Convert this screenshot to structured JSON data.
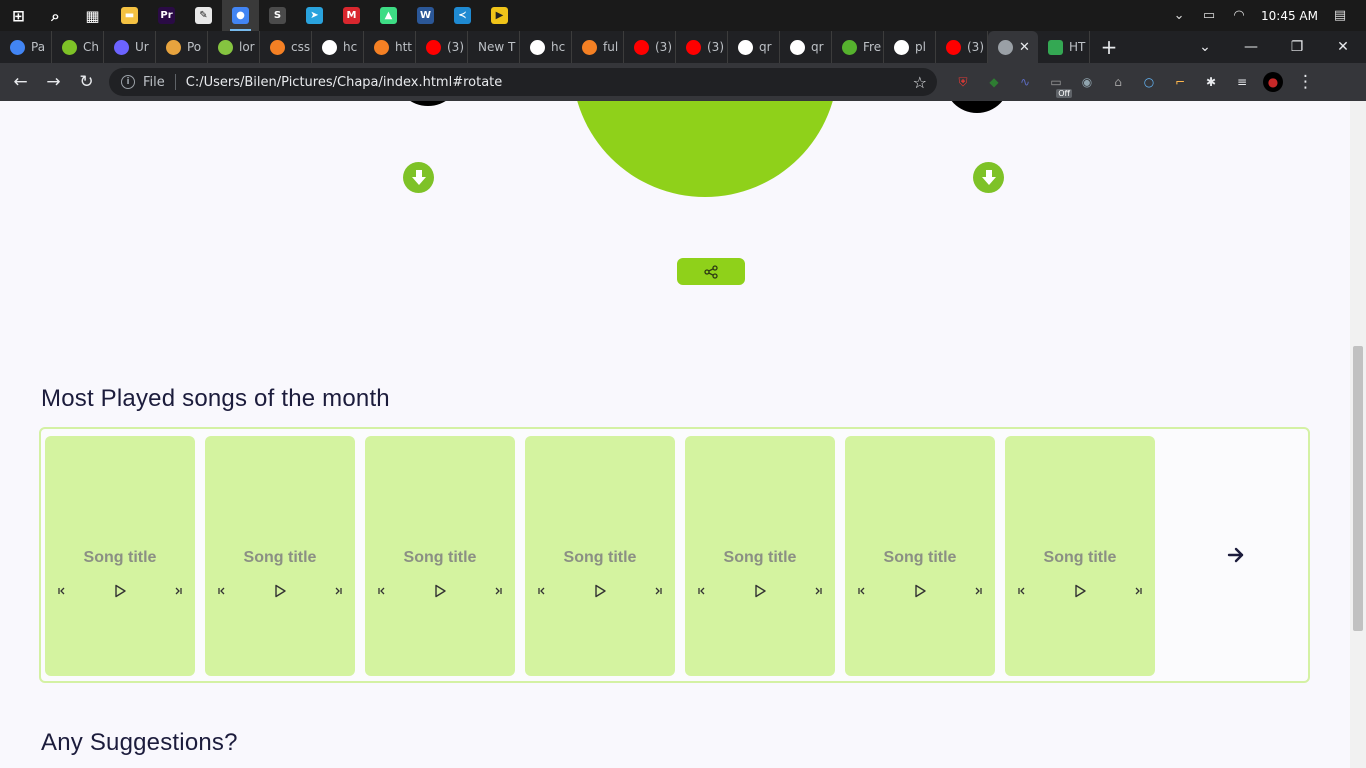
{
  "taskbar": {
    "apps": [
      {
        "name": "windows-start",
        "color": "#ffffff",
        "glyph": "⊞"
      },
      {
        "name": "search",
        "color": "#ffffff",
        "glyph": "⌕"
      },
      {
        "name": "task-view",
        "color": "#ffffff",
        "glyph": "▦"
      },
      {
        "name": "file-explorer",
        "color": "#f5c242",
        "glyph": "▬"
      },
      {
        "name": "premiere-pro",
        "color": "#2a0b45",
        "glyph": "Pr"
      },
      {
        "name": "paint",
        "color": "#e8e8e8",
        "glyph": "✎"
      },
      {
        "name": "chrome",
        "color": "#4285f4",
        "glyph": "●"
      },
      {
        "name": "sublime-text",
        "color": "#4b4b4b",
        "glyph": "S"
      },
      {
        "name": "telegram",
        "color": "#2aa3dd",
        "glyph": "➤"
      },
      {
        "name": "mega",
        "color": "#d9272e",
        "glyph": "M"
      },
      {
        "name": "android-studio",
        "color": "#3ddc84",
        "glyph": "▲"
      },
      {
        "name": "word",
        "color": "#2b5797",
        "glyph": "W"
      },
      {
        "name": "vscode",
        "color": "#1f8ad2",
        "glyph": "≺"
      },
      {
        "name": "media-player",
        "color": "#f0c419",
        "glyph": "▶"
      }
    ],
    "time": "10:45 AM"
  },
  "tabs": [
    {
      "label": "Pa",
      "color": "#4285f4"
    },
    {
      "label": "Ch",
      "color": "#7ec227"
    },
    {
      "label": "Ur",
      "color": "#6c63ff"
    },
    {
      "label": "Po",
      "color": "#e7a33e"
    },
    {
      "label": "lor",
      "color": "#85c440"
    },
    {
      "label": "css",
      "color": "#f48024"
    },
    {
      "label": "hc",
      "color": "#ffffff"
    },
    {
      "label": "htt",
      "color": "#f48024"
    },
    {
      "label": "(3)",
      "color": "#ff0000"
    },
    {
      "label": "New T",
      "color": "#202124"
    },
    {
      "label": "hc",
      "color": "#ffffff"
    },
    {
      "label": "ful",
      "color": "#f48024"
    },
    {
      "label": "(3)",
      "color": "#ff0000"
    },
    {
      "label": "(3)",
      "color": "#ff0000"
    },
    {
      "label": "qr",
      "color": "#ffffff"
    },
    {
      "label": "qr",
      "color": "#ffffff"
    },
    {
      "label": "Fre",
      "color": "#56b22e"
    },
    {
      "label": "pl",
      "color": "#ffffff"
    },
    {
      "label": "(3)",
      "color": "#ff0000"
    }
  ],
  "active_tab": {
    "label": "",
    "color": "#9aa0a6"
  },
  "last_tab": {
    "label": "HT",
    "color": "#34a853"
  },
  "toolbar": {
    "scheme_label": "File",
    "url": "C:/Users/Bilen/Pictures/Chapa/index.html#rotate"
  },
  "extensions": [
    {
      "name": "ublock",
      "color": "#e53935",
      "glyph": "⛨"
    },
    {
      "name": "ext-colorful",
      "color": "#2e7d32",
      "glyph": "◆"
    },
    {
      "name": "ext-wave",
      "color": "#5c6bc0",
      "glyph": "∿"
    },
    {
      "name": "ext-off",
      "color": "#9e9e9e",
      "glyph": "▭"
    },
    {
      "name": "ext-eye",
      "color": "#90a4ae",
      "glyph": "◉"
    },
    {
      "name": "ext-bottle",
      "color": "#9e9e9e",
      "glyph": "⌂"
    },
    {
      "name": "ext-ring",
      "color": "#64b5f6",
      "glyph": "○"
    },
    {
      "name": "ext-pick",
      "color": "#ffb74d",
      "glyph": "⌐"
    },
    {
      "name": "puzzle",
      "color": "#e8eaed",
      "glyph": "✱"
    },
    {
      "name": "reading-list",
      "color": "#e8eaed",
      "glyph": "≡"
    },
    {
      "name": "profile-avatar",
      "color": "#c62828",
      "glyph": "●"
    }
  ],
  "ext_badge": "Off",
  "page": {
    "accent": "#8fd11a",
    "section_most_played": "Most Played songs of the month",
    "section_suggestions": "Any Suggestions?",
    "songs": [
      {
        "title": "Song title"
      },
      {
        "title": "Song title"
      },
      {
        "title": "Song title"
      },
      {
        "title": "Song title"
      },
      {
        "title": "Song title"
      },
      {
        "title": "Song title"
      },
      {
        "title": "Song title"
      }
    ]
  }
}
